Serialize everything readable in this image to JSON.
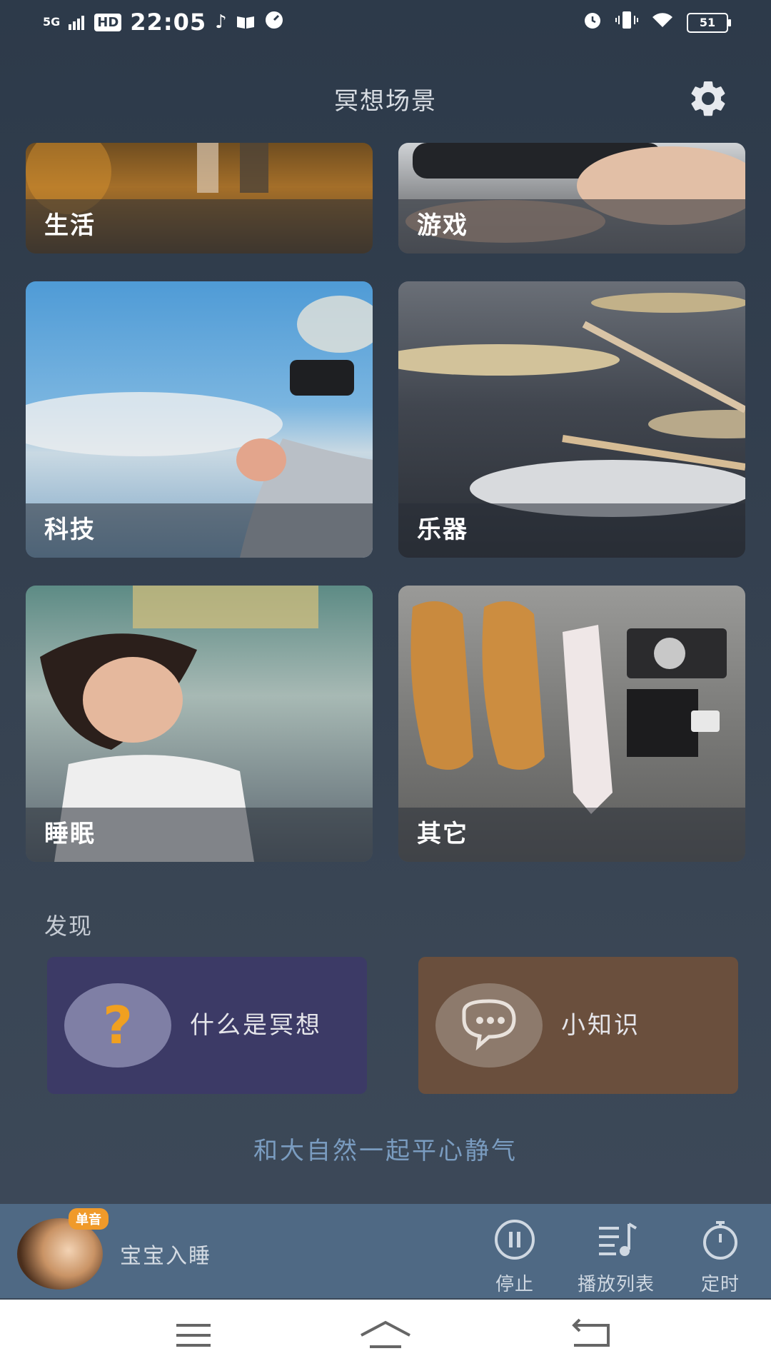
{
  "status_bar": {
    "network": "5G",
    "hd": "HD",
    "time": "22:05",
    "battery": "51"
  },
  "header": {
    "title": "冥想场景"
  },
  "scenes": [
    {
      "label": "生活"
    },
    {
      "label": "游戏"
    },
    {
      "label": "科技"
    },
    {
      "label": "乐器"
    },
    {
      "label": "睡眠"
    },
    {
      "label": "其它"
    }
  ],
  "discover": {
    "title": "发现",
    "cards": [
      {
        "label": "什么是冥想",
        "icon": "question-icon",
        "color": "#3c3a66"
      },
      {
        "label": "小知识",
        "icon": "chat-bubble-icon",
        "color": "#6a4f3d"
      }
    ]
  },
  "slogan": "和大自然一起平心静气",
  "player": {
    "badge": "单音",
    "track": "宝宝入睡",
    "controls": [
      {
        "label": "停止",
        "icon": "pause-icon"
      },
      {
        "label": "播放列表",
        "icon": "playlist-icon"
      },
      {
        "label": "定时",
        "icon": "timer-icon"
      }
    ],
    "bar_color": "#4f6984"
  },
  "colors": {
    "question_mark": "#f0a020",
    "slogan": "#7a9cc0"
  }
}
